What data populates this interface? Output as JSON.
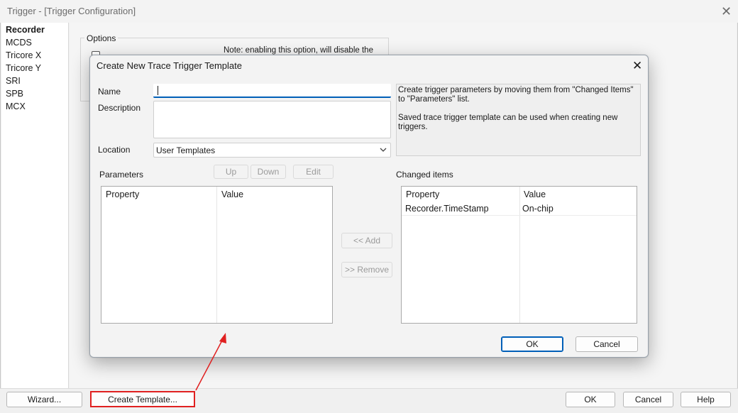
{
  "window": {
    "title": "Trigger - [Trigger Configuration]",
    "close_glyph": "✕"
  },
  "sidebar": {
    "items": [
      {
        "label": "Recorder",
        "selected": true
      },
      {
        "label": "MCDS"
      },
      {
        "label": "Tricore X"
      },
      {
        "label": "Tricore Y"
      },
      {
        "label": "SRI"
      },
      {
        "label": "SPB"
      },
      {
        "label": "MCX"
      }
    ]
  },
  "options": {
    "group_label": "Options",
    "note": "Note: enabling this option, will disable the"
  },
  "bottom_bar": {
    "wizard_label": "Wizard...",
    "create_template_label": "Create Template...",
    "ok_label": "OK",
    "cancel_label": "Cancel",
    "help_label": "Help"
  },
  "dialog": {
    "title": "Create New Trace Trigger Template",
    "close_glyph": "✕",
    "name_label": "Name",
    "name_value": "",
    "description_label": "Description",
    "description_value": "",
    "location_label": "Location",
    "location_value": "User Templates",
    "info_line1": "Create trigger parameters by moving them from \"Changed Items\" to \"Parameters\" list.",
    "info_line2": "Saved trace trigger template can be used when creating new triggers.",
    "parameters_label": "Parameters",
    "up_label": "Up",
    "down_label": "Down",
    "edit_label": "Edit",
    "add_label": "<< Add",
    "remove_label": ">> Remove",
    "changed_items_label": "Changed items",
    "parameters_table": {
      "columns": [
        "Property",
        "Value"
      ],
      "rows": []
    },
    "changed_table": {
      "columns": [
        "Property",
        "Value"
      ],
      "rows": [
        {
          "property": "Recorder.TimeStamp",
          "value": "On-chip"
        }
      ]
    },
    "ok_label": "OK",
    "cancel_label": "Cancel"
  },
  "colors": {
    "accent": "#005fb8",
    "annotation_red": "#e02020"
  }
}
